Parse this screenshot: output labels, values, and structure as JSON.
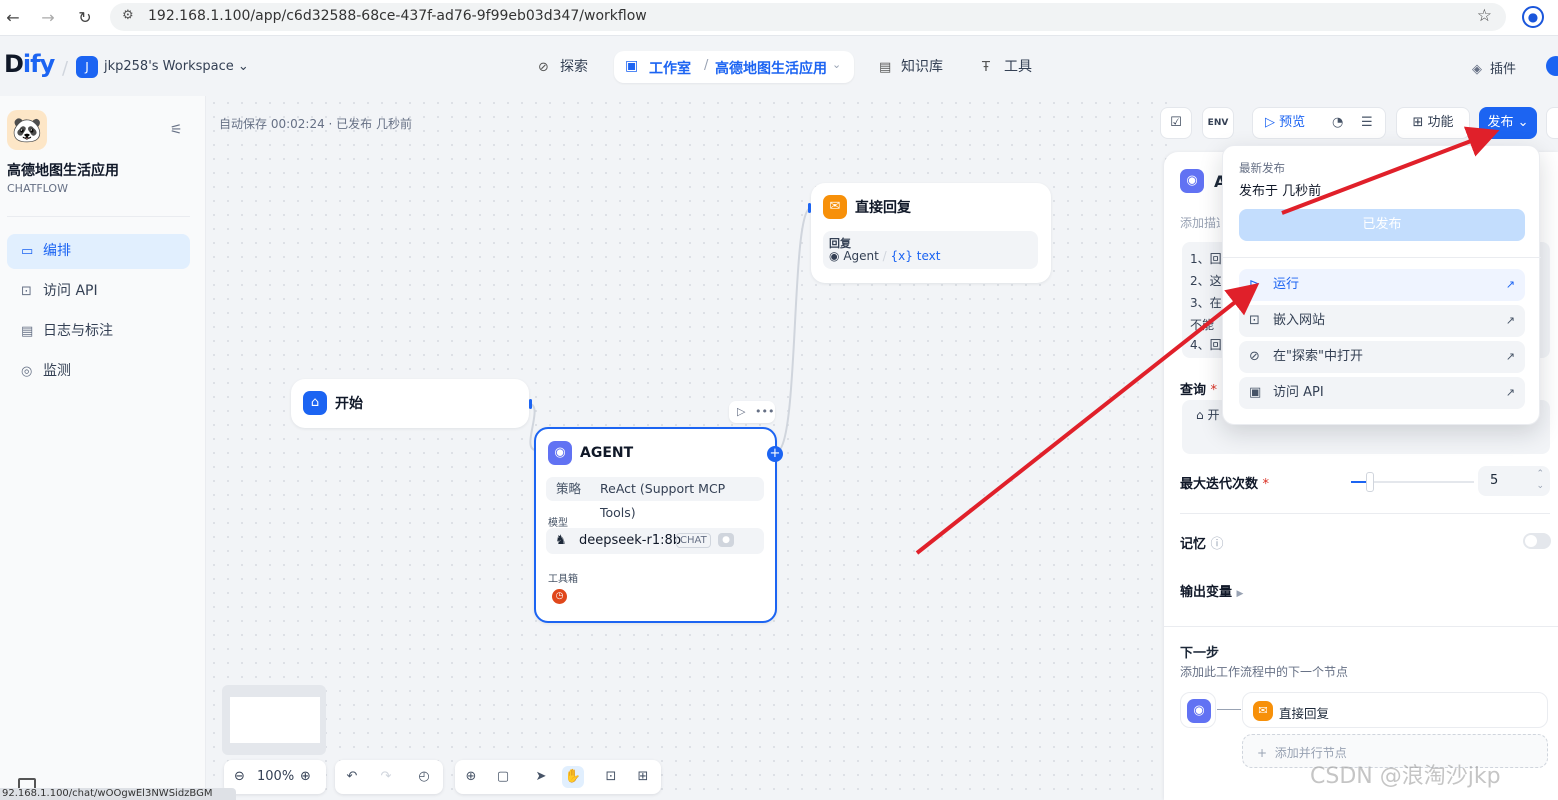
{
  "browser": {
    "url": "192.168.1.100/app/c6d32588-68ce-437f-ad76-9f99eb03d347/workflow",
    "back_icon": "←",
    "forward_icon": "→",
    "reload_icon": "↻",
    "star_icon": "☆",
    "status_url": "92.168.1.100/chat/wOOgwEl3NWSidzBGM"
  },
  "header": {
    "logo_d": "D",
    "logo_i": "i",
    "logo_fy": "fy",
    "workspace_initial": "J",
    "workspace_name": "jkp258's Workspace",
    "nav": {
      "explore": "探索",
      "studio": "工作室",
      "app_name": "高德地图生活应用",
      "knowledge": "知识库",
      "tools": "工具"
    },
    "plugins": "插件"
  },
  "sidebar": {
    "app_title": "高德地图生活应用",
    "app_type": "CHATFLOW",
    "items": [
      {
        "label": "编排",
        "icon": "layout-icon"
      },
      {
        "label": "访问 API",
        "icon": "terminal-icon"
      },
      {
        "label": "日志与标注",
        "icon": "file-list-icon"
      },
      {
        "label": "监测",
        "icon": "gauge-icon"
      }
    ]
  },
  "canvas": {
    "autosave": "自动保存 00:02:24 · 已发布 几秒前",
    "zoom": "100%",
    "nodes": {
      "start": {
        "title": "开始"
      },
      "reply": {
        "title": "直接回复",
        "field_label": "回复",
        "agent": "Agent",
        "var": "{x} text"
      },
      "agent": {
        "title": "AGENT",
        "strategy_key": "策略",
        "strategy_value": "ReAct (Support MCP Tools)",
        "model_label": "模型",
        "model_name": "deepseek-r1:8b",
        "model_badge": "CHAT",
        "tools_label": "工具箱"
      }
    }
  },
  "toolbar_right": {
    "preview": "预览",
    "features": "功能",
    "publish": "发布"
  },
  "right_panel": {
    "title": "A",
    "desc": "添加描述...",
    "instructions": [
      "1、回",
      "2、这",
      "3、在",
      "不能",
      "4、回"
    ],
    "query_label": "查询",
    "query_value": "开",
    "max_iter_label": "最大迭代次数",
    "max_iter_value": "5",
    "max_iter_fraction": 0.1,
    "memory_label": "记忆",
    "memory_on": false,
    "output_vars": "输出变量",
    "next_title": "下一步",
    "next_desc": "添加此工作流程中的下一个节点",
    "next_node": "直接回复",
    "add_parallel": "添加并行节点"
  },
  "publish_menu": {
    "latest_label": "最新发布",
    "published_time": "发布于 几秒前",
    "published_btn": "已发布",
    "items": [
      {
        "label": "运行",
        "icon": "play-circle-icon"
      },
      {
        "label": "嵌入网站",
        "icon": "embed-icon"
      },
      {
        "label": "在\"探索\"中打开",
        "icon": "compass-icon"
      },
      {
        "label": "访问 API",
        "icon": "terminal-icon"
      }
    ]
  },
  "watermark": "CSDN @浪淘沙jkp",
  "colors": {
    "accent": "#1c64f2",
    "arrow": "#e0202a",
    "agent_icon": "#6172f3",
    "reply_icon": "#f79009"
  }
}
